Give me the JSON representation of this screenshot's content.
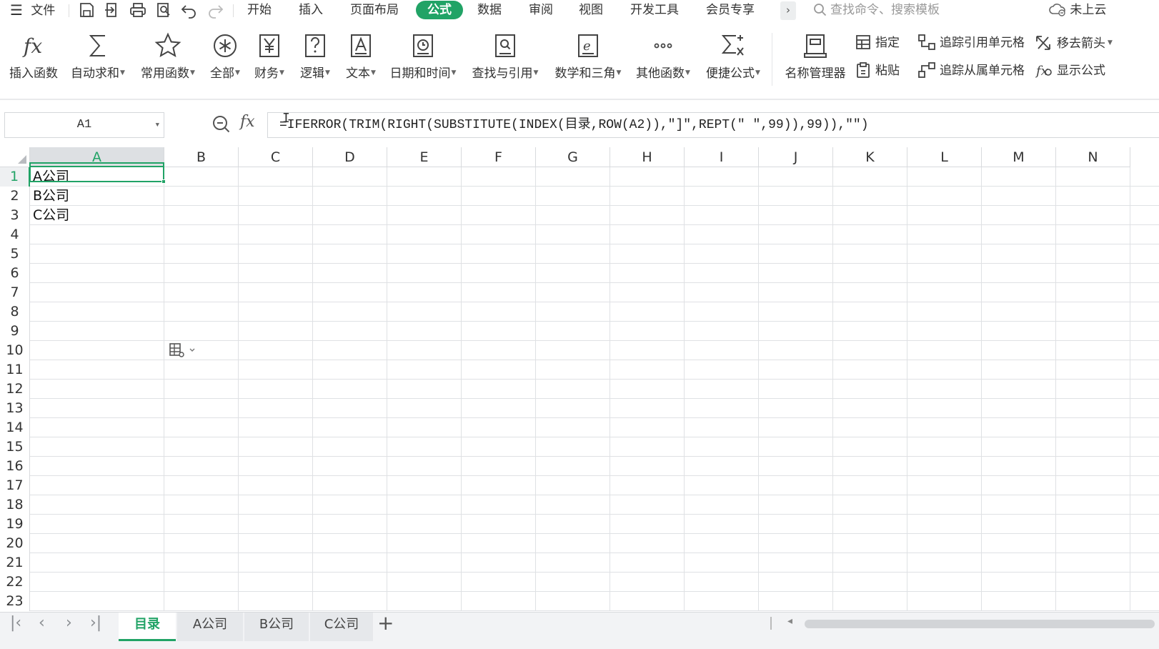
{
  "menubar": {
    "file": "文件",
    "tabs": [
      "开始",
      "插入",
      "页面布局",
      "公式",
      "数据",
      "审阅",
      "视图",
      "开发工具",
      "会员专享"
    ],
    "active_tab": "公式",
    "search_placeholder": "查找命令、搜索模板",
    "cloud": "未上云"
  },
  "ribbon": {
    "buttons": [
      {
        "label": "插入函数",
        "icon": "fx-icon",
        "dropdown": false
      },
      {
        "label": "自动求和",
        "icon": "sigma-icon",
        "dropdown": true
      },
      {
        "label": "常用函数",
        "icon": "star-icon",
        "dropdown": true
      },
      {
        "label": "全部",
        "icon": "asterisk-circle-icon",
        "dropdown": true
      },
      {
        "label": "财务",
        "icon": "yen-icon",
        "dropdown": true
      },
      {
        "label": "逻辑",
        "icon": "question-icon",
        "dropdown": true
      },
      {
        "label": "文本",
        "icon": "text-a-icon",
        "dropdown": true
      },
      {
        "label": "日期和时间",
        "icon": "clock-icon",
        "dropdown": true
      },
      {
        "label": "查找与引用",
        "icon": "lookup-icon",
        "dropdown": true
      },
      {
        "label": "数学和三角",
        "icon": "math-icon",
        "dropdown": true
      },
      {
        "label": "其他函数",
        "icon": "more-dots-icon",
        "dropdown": true
      },
      {
        "label": "便捷公式",
        "icon": "quick-formula-icon",
        "dropdown": true
      },
      {
        "label": "名称管理器",
        "icon": "name-manager-icon",
        "dropdown": false
      }
    ],
    "small": {
      "define": "指定",
      "paste": "粘贴",
      "trace_precedents": "追踪引用单元格",
      "trace_dependents": "追踪从属单元格",
      "remove_arrows": "移去箭头",
      "show_formulas": "显示公式"
    }
  },
  "formula_bar": {
    "name_box": "A1",
    "fx": "fx",
    "formula": "=IFERROR(TRIM(RIGHT(SUBSTITUTE(INDEX(目录,ROW(A2)),\"]\",REPT(\" \",99)),99)),\"\")"
  },
  "grid": {
    "columns": [
      "A",
      "B",
      "C",
      "D",
      "E",
      "F",
      "G",
      "H",
      "I",
      "J",
      "K",
      "L",
      "M",
      "N"
    ],
    "rows": [
      "1",
      "2",
      "3",
      "4",
      "5",
      "6",
      "7",
      "8",
      "9",
      "10",
      "11",
      "12",
      "13",
      "14",
      "15",
      "16",
      "17",
      "18",
      "19",
      "20",
      "21",
      "22",
      "23"
    ],
    "selected_cell": "A1",
    "cells": {
      "A1": "A公司",
      "A2": "B公司",
      "A3": "C公司"
    }
  },
  "sheets": {
    "tabs": [
      "目录",
      "A公司",
      "B公司",
      "C公司"
    ],
    "active": "目录",
    "add": "+"
  },
  "colors": {
    "accent": "#21a366"
  }
}
